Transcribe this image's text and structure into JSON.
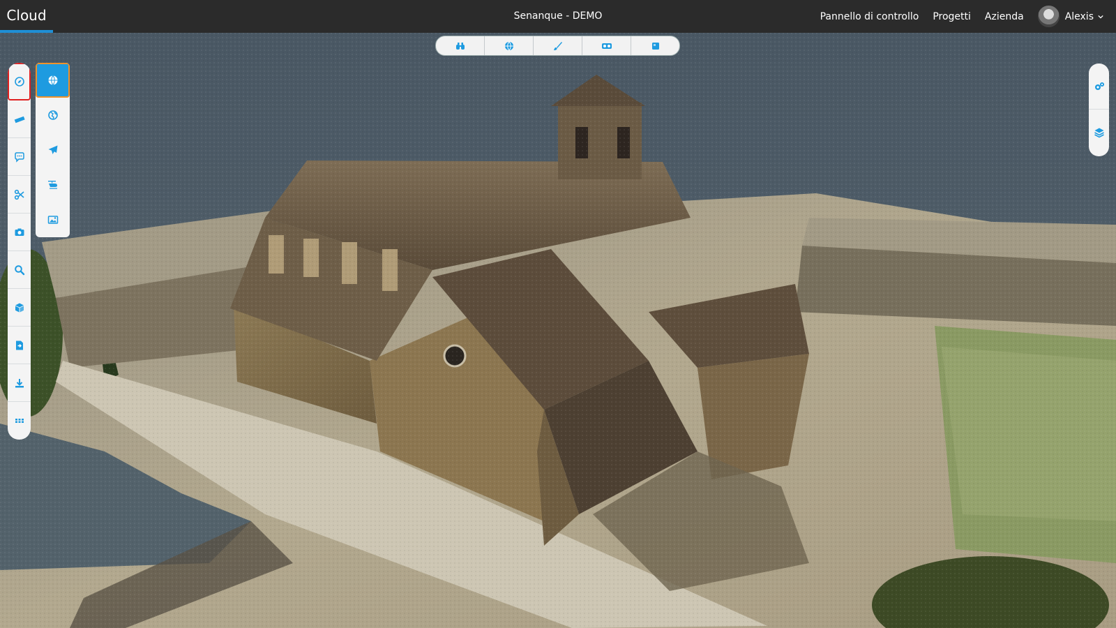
{
  "header": {
    "brand": "Cloud",
    "project_title": "Senanque - DEMO",
    "nav": [
      "Pannello di controllo",
      "Progetti",
      "Azienda"
    ],
    "user_name": "Alexis"
  },
  "colors": {
    "accent": "#1e9be0",
    "topbar": "#2b2b2b",
    "active_outline": "#e02020",
    "sub_active_outline": "#f0922a"
  },
  "top_toolbar": [
    {
      "icon": "binoculars-icon"
    },
    {
      "icon": "globe-icon"
    },
    {
      "icon": "brush-icon"
    },
    {
      "icon": "vr-headset-icon"
    },
    {
      "icon": "square-view-icon"
    }
  ],
  "left_toolbar": [
    {
      "icon": "compass-icon",
      "active": true
    },
    {
      "icon": "ruler-icon"
    },
    {
      "icon": "comment-icon"
    },
    {
      "icon": "scissors-icon"
    },
    {
      "icon": "camera-icon"
    },
    {
      "icon": "search-icon"
    },
    {
      "icon": "cube-icon"
    },
    {
      "icon": "file-import-icon"
    },
    {
      "icon": "download-icon"
    },
    {
      "icon": "grid-icon"
    }
  ],
  "sub_toolbar": [
    {
      "icon": "globe-icon",
      "active": true
    },
    {
      "icon": "earth-icon"
    },
    {
      "icon": "paper-plane-icon"
    },
    {
      "icon": "helicopter-icon"
    },
    {
      "icon": "image-icon"
    }
  ],
  "right_toolbar": [
    {
      "icon": "settings-gears-icon"
    },
    {
      "icon": "layers-icon"
    }
  ]
}
